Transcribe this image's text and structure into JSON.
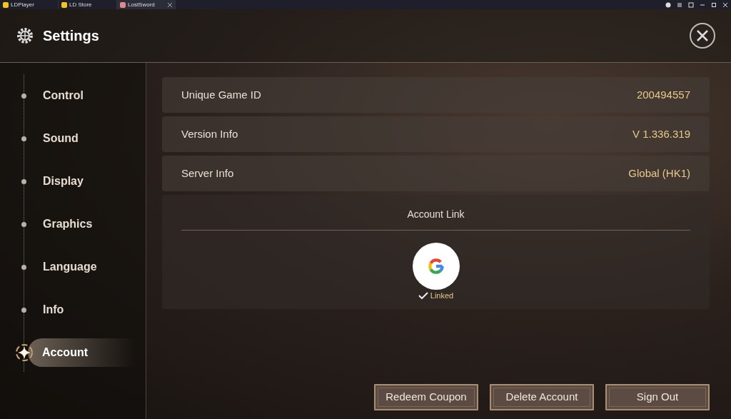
{
  "app_tabs": [
    {
      "label": "LDPlayer",
      "selected": false
    },
    {
      "label": "LD Store",
      "selected": false
    },
    {
      "label": "LostSword",
      "selected": true
    }
  ],
  "header": {
    "title": "Settings"
  },
  "sidebar": {
    "items": [
      {
        "label": "Control",
        "selected": false
      },
      {
        "label": "Sound",
        "selected": false
      },
      {
        "label": "Display",
        "selected": false
      },
      {
        "label": "Graphics",
        "selected": false
      },
      {
        "label": "Language",
        "selected": false
      },
      {
        "label": "Info",
        "selected": false
      },
      {
        "label": "Account",
        "selected": true
      }
    ]
  },
  "info_rows": [
    {
      "label": "Unique Game ID",
      "value": "200494557"
    },
    {
      "label": "Version Info",
      "value": "V 1.336.319"
    },
    {
      "label": "Server Info",
      "value": "Global (HK1)"
    }
  ],
  "account_link": {
    "title": "Account Link",
    "linked": true,
    "status": "Linked"
  },
  "buttons": [
    "Redeem Coupon",
    "Delete Account",
    "Sign Out"
  ]
}
